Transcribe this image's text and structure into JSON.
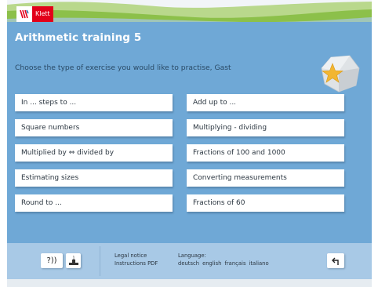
{
  "brand": {
    "logo_text": "Klett"
  },
  "app": {
    "title": "Arithmetic training 5"
  },
  "prompt": "Choose the type of exercise you would like to practise, Gast",
  "exercises_left": [
    {
      "label": "In ... steps to ..."
    },
    {
      "label": "Square numbers"
    },
    {
      "label": "Multiplied by ⇔ divided by"
    },
    {
      "label": "Estimating sizes"
    },
    {
      "label": "Round to ..."
    }
  ],
  "exercises_right": [
    {
      "label": "Add up to ..."
    },
    {
      "label": "Multiplying - dividing"
    },
    {
      "label": "Fractions of 100 and 1000"
    },
    {
      "label": "Converting measurements"
    },
    {
      "label": "Fractions of 60"
    }
  ],
  "footer": {
    "help_label": "?))",
    "rank_label": "1",
    "legal_notice": "Legal notice",
    "instructions_pdf": "Instructions PDF",
    "language_label": "Language:",
    "languages": [
      "deutsch",
      "english",
      "français",
      "italiano"
    ],
    "back_icon": "back-arrow-icon"
  },
  "colors": {
    "main_bg": "#6fa8d6",
    "footer_bg": "#a8c9e6",
    "brand_red": "#e2001a",
    "star_yellow": "#f2b632",
    "green_strip": "#8cc04a"
  }
}
